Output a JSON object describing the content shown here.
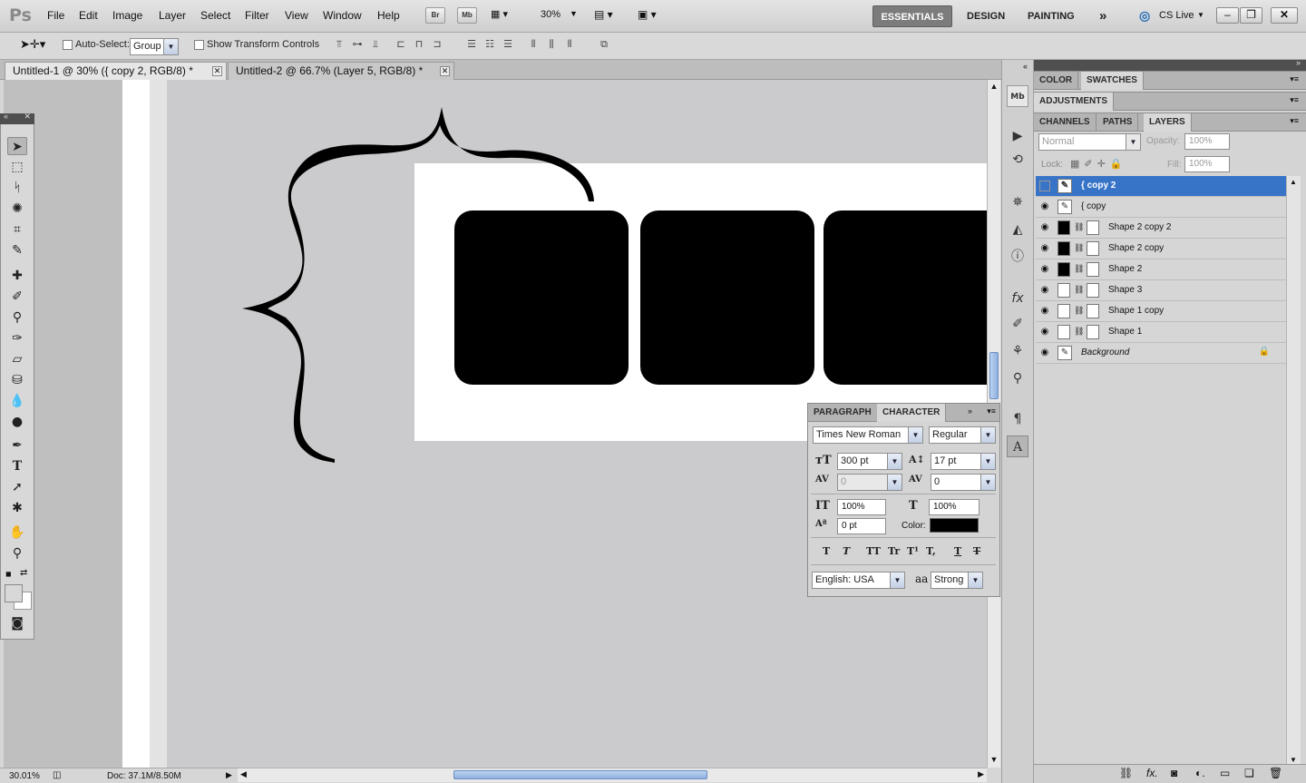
{
  "app": {
    "logo": "Ps"
  },
  "menu": [
    "File",
    "Edit",
    "Image",
    "Layer",
    "Select",
    "Filter",
    "View",
    "Window",
    "Help"
  ],
  "app_bar": {
    "bridge": "Br",
    "mini_bridge": "Mb",
    "zoom": "30%"
  },
  "workspaces": {
    "essentials": "ESSENTIALS",
    "design": "DESIGN",
    "painting": "PAINTING",
    "more": "»",
    "cs_live": "CS Live"
  },
  "options": {
    "auto_select_label": "Auto-Select:",
    "auto_select_value": "Group",
    "transform_label": "Show Transform Controls"
  },
  "tabs": [
    {
      "label": "Untitled-1 @ 30% ({ copy 2, RGB/8) *",
      "active": true
    },
    {
      "label": "Untitled-2 @ 66.7% (Layer 5, RGB/8) *",
      "active": false
    }
  ],
  "status": {
    "zoom": "30.01%",
    "doc": "Doc: 37.1M/8.50M"
  },
  "panels": {
    "top_tabs": [
      "COLOR",
      "SWATCHES"
    ],
    "adjustments": "ADJUSTMENTS",
    "layer_tabs": [
      "CHANNELS",
      "PATHS",
      "LAYERS"
    ],
    "blend_mode": "Normal",
    "opacity_label": "Opacity:",
    "opacity_value": "100%",
    "lock_label": "Lock:",
    "fill_label": "Fill:",
    "fill_value": "100%"
  },
  "layers": [
    {
      "name": "{ copy 2",
      "type": "text",
      "visible": false,
      "active": true
    },
    {
      "name": "{ copy",
      "type": "text",
      "visible": true,
      "active": false
    },
    {
      "name": "Shape 2 copy 2",
      "type": "shape",
      "visible": true,
      "active": false
    },
    {
      "name": "Shape 2 copy",
      "type": "shape",
      "visible": true,
      "active": false
    },
    {
      "name": "Shape 2",
      "type": "shape",
      "visible": true,
      "active": false
    },
    {
      "name": "Shape 3",
      "type": "shape",
      "visible": true,
      "active": false
    },
    {
      "name": "Shape 1 copy",
      "type": "shape",
      "visible": true,
      "active": false
    },
    {
      "name": "Shape 1",
      "type": "shape",
      "visible": true,
      "active": false
    },
    {
      "name": "Background",
      "type": "background",
      "visible": true,
      "active": false
    }
  ],
  "character": {
    "tabs": [
      "PARAGRAPH",
      "CHARACTER"
    ],
    "font_family": "Times New Roman",
    "font_style": "Regular",
    "font_size": "300 pt",
    "leading": "17 pt",
    "kerning": "0",
    "tracking": "0",
    "vertical_scale": "100%",
    "horizontal_scale": "100%",
    "baseline_shift": "0 pt",
    "color_label": "Color:",
    "color_value": "#000000",
    "language": "English: USA",
    "antialias": "Strong",
    "aa_label": "aa",
    "format_buttons": [
      "T",
      "T",
      "TT",
      "Tr",
      "T¹",
      "T,",
      "T",
      "T"
    ]
  }
}
